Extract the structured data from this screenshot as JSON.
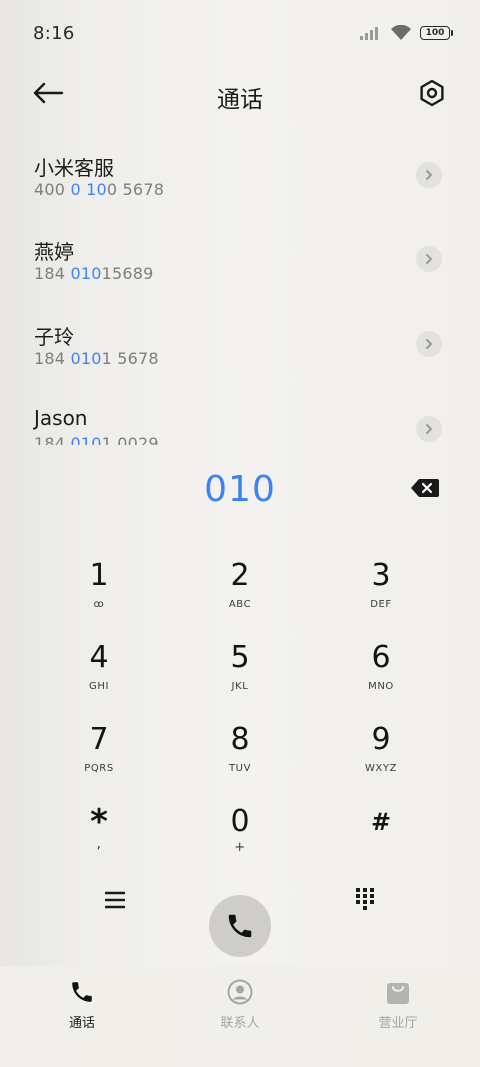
{
  "status_bar": {
    "time": "8:16",
    "battery": "100"
  },
  "header": {
    "title": "通话"
  },
  "results": [
    {
      "name": "小米客服",
      "number_parts": [
        {
          "text": "400 ",
          "hl": false
        },
        {
          "text": "0",
          "hl": true
        },
        {
          "text": " ",
          "hl": false
        },
        {
          "text": "10",
          "hl": true
        },
        {
          "text": "0 5678",
          "hl": false
        }
      ]
    },
    {
      "name": "燕婷",
      "number_parts": [
        {
          "text": "184 ",
          "hl": false
        },
        {
          "text": "010",
          "hl": true
        },
        {
          "text": "15689",
          "hl": false
        }
      ]
    },
    {
      "name": "子玲",
      "number_parts": [
        {
          "text": "184 ",
          "hl": false
        },
        {
          "text": "010",
          "hl": true
        },
        {
          "text": "1 5678",
          "hl": false
        }
      ]
    },
    {
      "name": "Jason",
      "number_parts": [
        {
          "text": "184 ",
          "hl": false
        },
        {
          "text": "010",
          "hl": true
        },
        {
          "text": "1 0029",
          "hl": false
        }
      ]
    }
  ],
  "dial": {
    "number": "010"
  },
  "keypad": [
    {
      "digit": "1",
      "letters": "ꝏ"
    },
    {
      "digit": "2",
      "letters": "ABC"
    },
    {
      "digit": "3",
      "letters": "DEF"
    },
    {
      "digit": "4",
      "letters": "GHI"
    },
    {
      "digit": "5",
      "letters": "JKL"
    },
    {
      "digit": "6",
      "letters": "MNO"
    },
    {
      "digit": "7",
      "letters": "PQRS"
    },
    {
      "digit": "8",
      "letters": "TUV"
    },
    {
      "digit": "9",
      "letters": "WXYZ"
    },
    {
      "digit": "*",
      "letters": ","
    },
    {
      "digit": "0",
      "letters": "+"
    },
    {
      "digit": "#",
      "letters": ""
    }
  ],
  "bottom_nav": [
    {
      "label": "通话",
      "icon": "phone-icon",
      "active": true
    },
    {
      "label": "联系人",
      "icon": "contacts-icon",
      "active": false
    },
    {
      "label": "营业厅",
      "icon": "shopping-bag-icon",
      "active": false
    }
  ],
  "colors": {
    "accent": "#3d84f2",
    "background": "#f3f2ee",
    "call_button": "#cfcdca"
  }
}
